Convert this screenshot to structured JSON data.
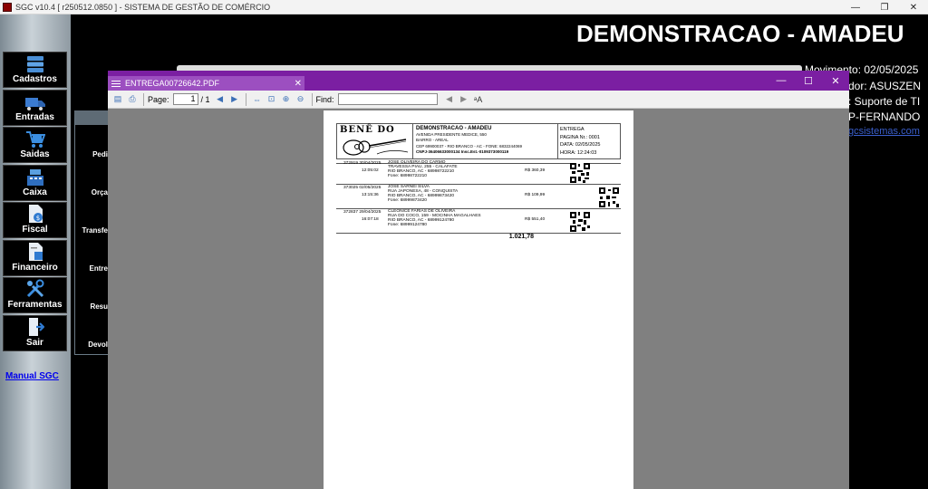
{
  "window": {
    "title": "SGC v10.4 [ r250512.0850 ] - SISTEMA DE GESTÃO DE COMÉRCIO",
    "minimize": "—",
    "restore": "❐",
    "close": "✕"
  },
  "sidebar": {
    "items": [
      {
        "label": "Cadastros",
        "icon": "database-icon"
      },
      {
        "label": "Entradas",
        "icon": "truck-icon"
      },
      {
        "label": "Saidas",
        "icon": "cart-icon"
      },
      {
        "label": "Caixa",
        "icon": "cash-register-icon"
      },
      {
        "label": "Fiscal",
        "icon": "document-dollar-icon"
      },
      {
        "label": "Financeiro",
        "icon": "finance-document-icon"
      },
      {
        "label": "Ferramentas",
        "icon": "tools-icon"
      },
      {
        "label": "Sair",
        "icon": "exit-door-icon"
      }
    ],
    "manual_link": "Manual SGC"
  },
  "header": {
    "company": "DEMONSTRACAO - AMADEU",
    "movimento": "Movimento: 02/05/2025",
    "usuario": "dor: ASUSZEN",
    "suporte": ": Suporte de TI",
    "filial": "P-FERNANDO",
    "email": "gcsistemas.com"
  },
  "background_panel": {
    "items": [
      "Pedi",
      "Orça",
      "Transfe",
      "Entre",
      "Resu",
      "Devol"
    ]
  },
  "pdf_viewer": {
    "tab_title": "ENTREGA00726642.PDF",
    "tab_close": "✕",
    "minimize": "—",
    "maximize": "☐",
    "close": "✕",
    "toolbar": {
      "page_label": "Page:",
      "page_current": "1",
      "page_total": "/ 1",
      "find_label": "Find:"
    }
  },
  "document": {
    "logo_text": "BENÊ DO",
    "company_name": "DEMONSTRACAO - AMADEU",
    "address": "AVENIDA PRESIDENTE MEDICE, 550",
    "district": "BAIRRO - AREAL",
    "cep": "CEP 69900037 - RIO BRANCO - AC - FONE: 6832244069",
    "cnpj": "CNPJ-36406633000134  Insc.Est.-0109373000119",
    "doc_type": "ENTREGA",
    "page": "PAGINA Nr.: 0001",
    "date": "DATA: 02/05/2025",
    "time": "HORA: 12:24:03",
    "records": [
      {
        "id": "372919",
        "date": "30/04/2025",
        "time": "12:05:02",
        "name": "JOSE OLIVEIRA DO CARMO",
        "street": "TRAVESSA PIAU,          255 - CALAFATE",
        "city": "RIO BRANCO, AC - 68998722210",
        "phone": "Fone: 68998722210",
        "value": "R$ 360,39"
      },
      {
        "id": "373025",
        "date": "02/05/2025",
        "time": "13:15:36",
        "name": "JOSE SARNEI SILVA",
        "street": "RUA JAPONESA,           48 - CONQUISTA",
        "city": "RIO BRANCO, AC - 68999873420",
        "phone": "Fone: 68999873420",
        "value": "R$ 109,99"
      },
      {
        "id": "372837",
        "date": "29/04/2025",
        "time": "16:07:18",
        "name": "CLEONICE FARIAS DE OLIVEIRA",
        "street": "RUA DO COCO,           159 - MOCINHA MAGALHAES",
        "city": "RIO BRANCO, AC - 68999124780",
        "phone": "Fone: 68999124780",
        "value": "R$ 551,40"
      }
    ],
    "total": "1.021,78"
  }
}
